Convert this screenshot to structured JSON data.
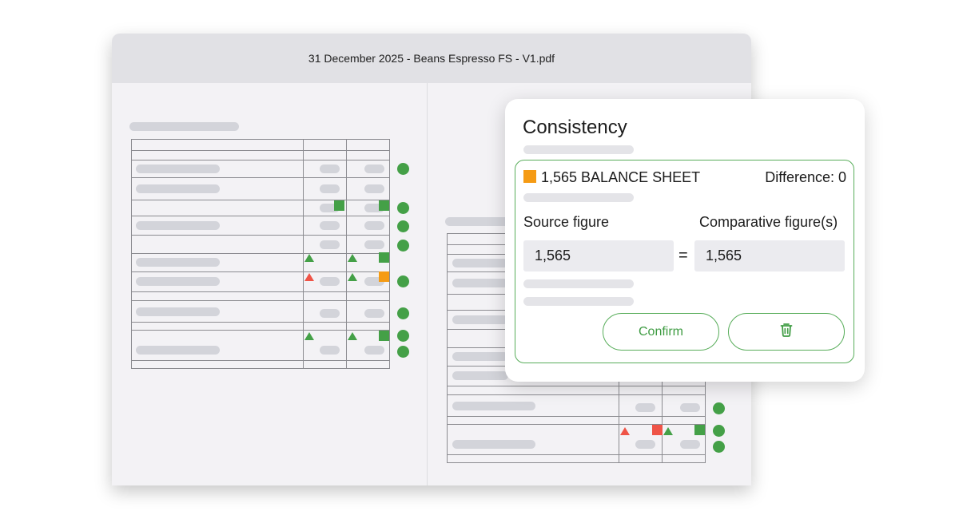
{
  "document": {
    "title": "31 December 2025 - Beans Espresso FS - V1.pdf"
  },
  "consistency_panel": {
    "title": "Consistency",
    "item": {
      "label": "1,565 BALANCE SHEET",
      "difference": "Difference: 0",
      "status_color": "#f59b14"
    },
    "source_label": "Source figure",
    "comparative_label": "Comparative figure(s)",
    "source_value": "1,565",
    "equals_sign": "=",
    "comparative_value": "1,565",
    "confirm_label": "Confirm",
    "delete_icon": "trash-icon"
  },
  "colors": {
    "ok": "#44a047",
    "warning": "#f59b14",
    "error": "#ef5447",
    "accent": "#58ad5a"
  }
}
